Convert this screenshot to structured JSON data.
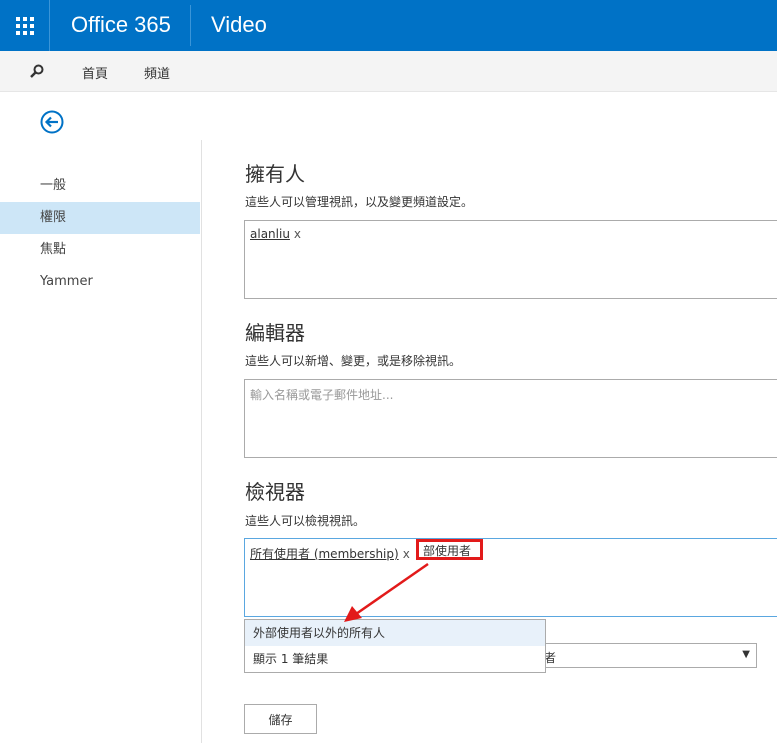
{
  "header": {
    "brand": "Office 365",
    "app_name": "Video"
  },
  "subnav": {
    "search_icon": "search-icon",
    "items": [
      "首頁",
      "頻道"
    ]
  },
  "back_icon": "back-arrow-icon",
  "sidebar": {
    "items": [
      "一般",
      "權限",
      "焦點",
      "Yammer"
    ],
    "active_index": 1
  },
  "owners": {
    "title": "擁有人",
    "description": "這些人可以管理視訊，以及變更頻道設定。",
    "tokens": [
      {
        "label": "alanliu",
        "remove": "x"
      }
    ]
  },
  "editors": {
    "title": "編輯器",
    "description": "這些人可以新增、變更，或是移除視訊。",
    "placeholder": "輸入名稱或電子郵件地址..."
  },
  "viewers": {
    "title": "檢視器",
    "description": "這些人可以檢視視訊。",
    "tokens": [
      {
        "label": "所有使用者 (membership)",
        "remove": "x"
      }
    ],
    "typed_text": "部使用者"
  },
  "suggestions": {
    "items": [
      "外部使用者以外的所有人"
    ],
    "result_count": "顯示 1 筆結果"
  },
  "select": {
    "value": "者"
  },
  "save_label": "儲存",
  "colors": {
    "brand": "#0072c6",
    "highlight": "#e21a1a",
    "selected": "#cde6f7"
  }
}
